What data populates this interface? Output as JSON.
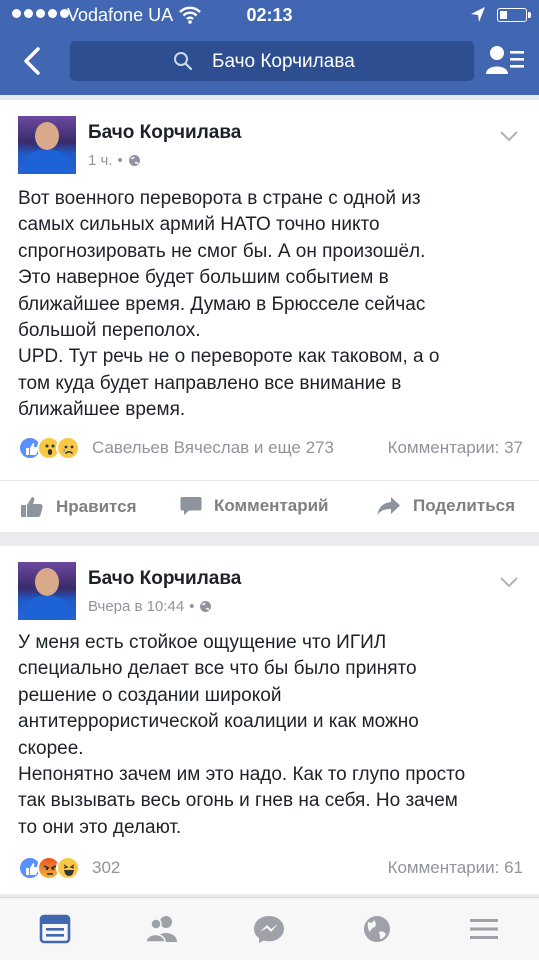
{
  "status_bar": {
    "carrier": "Vodafone UA",
    "time": "02:13"
  },
  "nav": {
    "search_text": "Бачо Корчилава"
  },
  "posts": [
    {
      "author": "Бачо Корчилава",
      "time": "1 ч.",
      "privacy": "public",
      "text": "Вот военного переворота в стране с одной из\nсамых сильных армий НАТО точно никто\nспрогнозировать не смог бы. А он произошёл.\nЭто наверное будет большим событием в\nближайшее время. Думаю в Брюсселе сейчас\nбольшой переполох.\nUPD. Тут речь не о перевороте как таковом, а о\nтом куда будет направлено все внимание в\nближайшее время.",
      "reactions": [
        "like",
        "wow",
        "sad"
      ],
      "reaction_summary": "Савельев Вячеслав и еще 273",
      "comments": "Комментарии: 37"
    },
    {
      "author": "Бачо Корчилава",
      "time": "Вчера в 10:44",
      "privacy": "public",
      "text": "У меня есть стойкое ощущение что ИГИЛ\nспециально делает все что бы было принято\nрешение о создании широкой\nантитеррористической коалиции и как можно\nскорее.\nНепонятно зачем им это надо. Как то глупо просто\nтак вызывать весь огонь и гнев на себя. Но зачем\nто они это делают.",
      "reactions": [
        "like",
        "angry",
        "haha"
      ],
      "reaction_count": "302",
      "comments": "Комментарии: 61"
    }
  ],
  "actions": {
    "like": "Нравится",
    "comment": "Комментарий",
    "share": "Поделиться"
  },
  "tabs": [
    "news-feed",
    "friends",
    "messenger",
    "notifications",
    "menu"
  ],
  "colors": {
    "brand": "#4267b2",
    "search_bg": "#2d4e90",
    "meta": "#90949c",
    "active_tab": "#4267b2",
    "inactive_tab": "#9ea2a8"
  }
}
